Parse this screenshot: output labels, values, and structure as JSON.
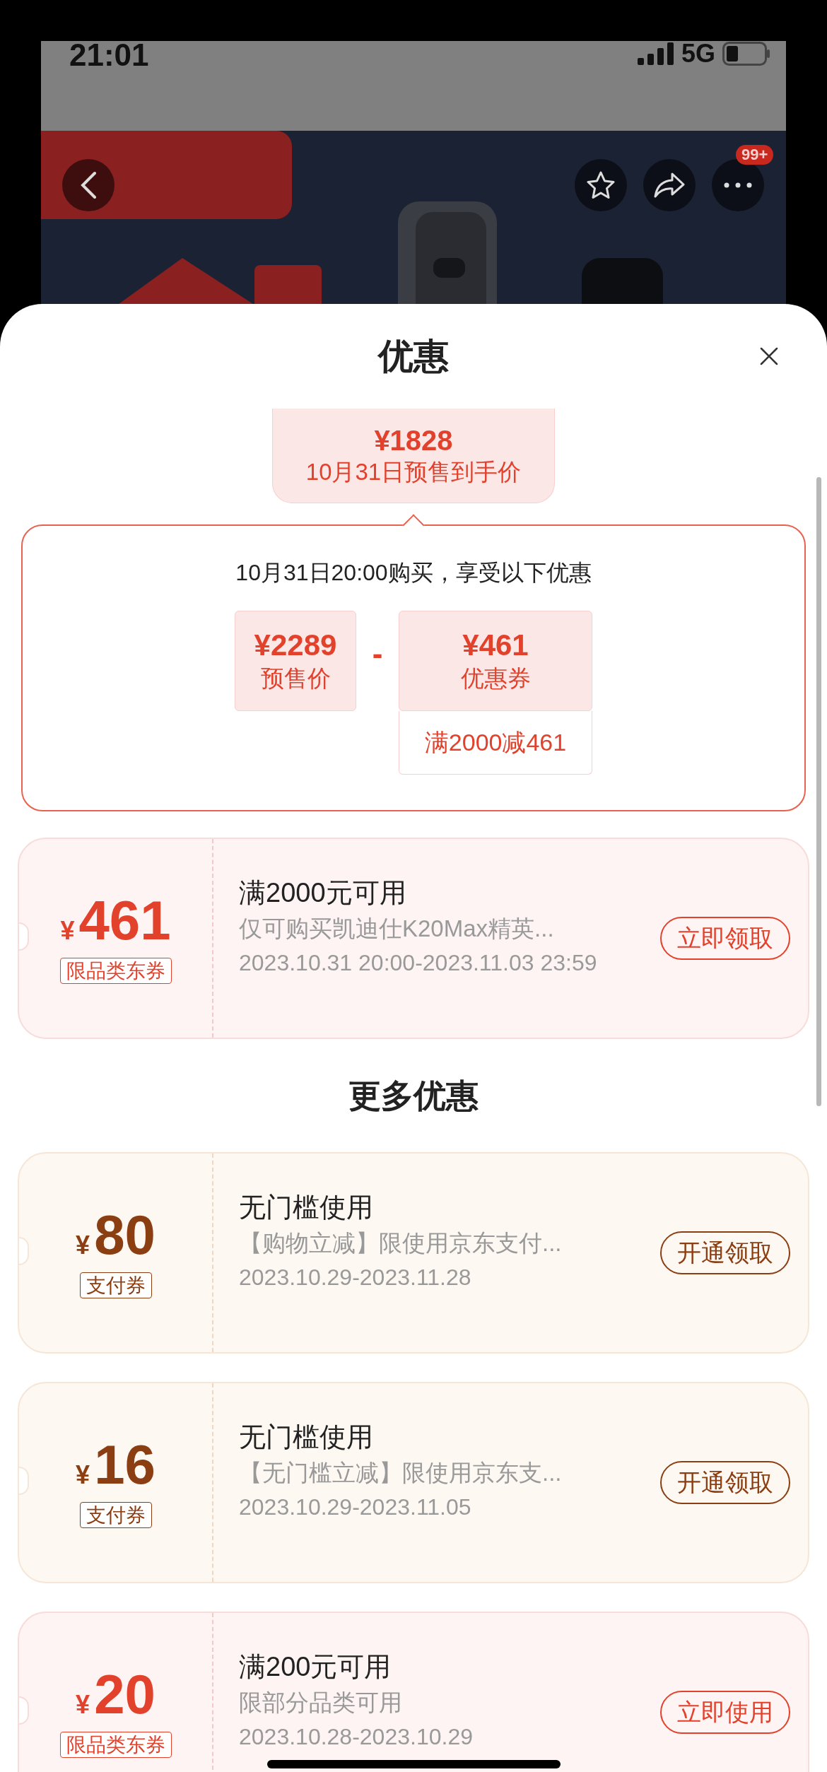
{
  "status_bar": {
    "time": "21:01",
    "network": "5G"
  },
  "product_header": {
    "more_badge": "99+"
  },
  "sheet": {
    "title": "优惠"
  },
  "price_summary": {
    "price": "¥1828",
    "label": "10月31日预售到手价"
  },
  "breakdown": {
    "heading": "10月31日20:00购买，享受以下优惠",
    "presale": {
      "price": "¥2289",
      "label": "预售价"
    },
    "operator": "-",
    "coupon": {
      "price": "¥461",
      "label": "优惠券",
      "condition": "满2000减461"
    }
  },
  "coupons": [
    {
      "kind": "store",
      "currency": "¥",
      "amount": "461",
      "tag": "限品类东券",
      "title": "满2000元可用",
      "description": "仅可购买凯迪仕K20Max精英...",
      "validity": "2023.10.31 20:00-2023.11.03 23:59",
      "button": "立即领取"
    }
  ],
  "more_heading": "更多优惠",
  "more_coupons": [
    {
      "kind": "payment",
      "currency": "¥",
      "amount": "80",
      "tag": "支付券",
      "title": "无门槛使用",
      "description": "【购物立减】限使用京东支付...",
      "validity": "2023.10.29-2023.11.28",
      "button": "开通领取"
    },
    {
      "kind": "payment",
      "currency": "¥",
      "amount": "16",
      "tag": "支付券",
      "title": "无门槛使用",
      "description": "【无门槛立减】限使用京东支...",
      "validity": "2023.10.29-2023.11.05",
      "button": "开通领取"
    },
    {
      "kind": "store",
      "currency": "¥",
      "amount": "20",
      "tag": "限品类东券",
      "title": "满200元可用",
      "description": "限部分品类可用",
      "validity": "2023.10.28-2023.10.29",
      "button": "立即使用"
    }
  ]
}
